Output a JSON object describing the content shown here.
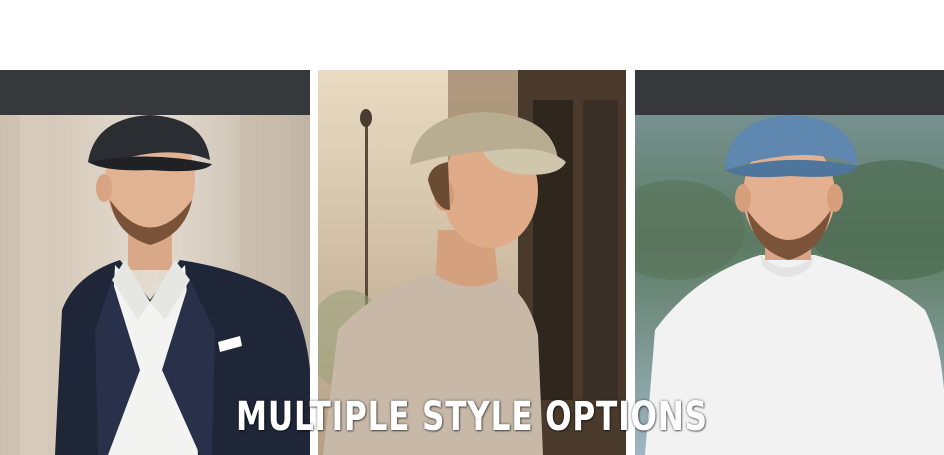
{
  "banner": {
    "headline": "MULTIPLE STYLE OPTIONS"
  },
  "panels": [
    {
      "cap_color": "#2a2d31",
      "garment": "navy-blazer-white-shirt"
    },
    {
      "cap_color": "#b8ad90",
      "garment": "beige-tshirt"
    },
    {
      "cap_color": "#5f87b0",
      "garment": "white-tshirt"
    }
  ],
  "colors": {
    "header_bar": "#37383c",
    "background": "#ffffff"
  }
}
